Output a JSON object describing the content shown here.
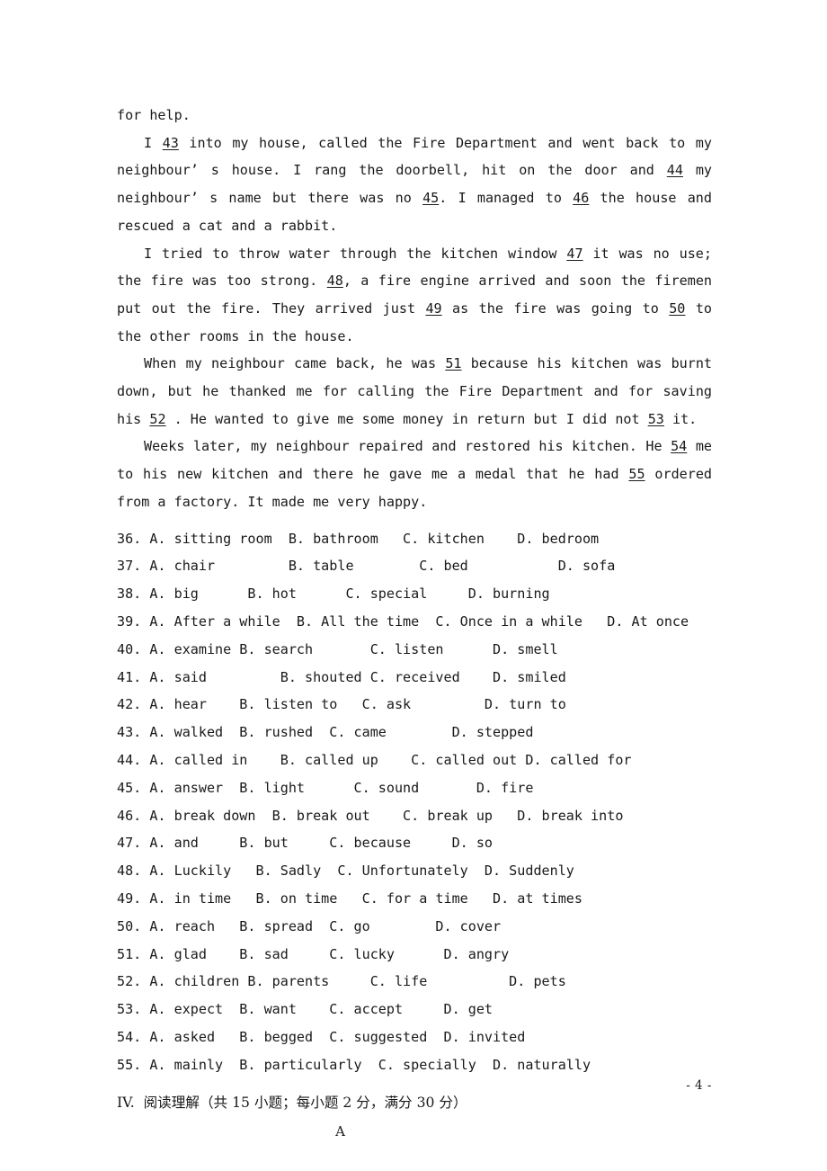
{
  "document": {
    "page_number": "- 4 -",
    "paragraphs": [
      {
        "id": "p-continuation",
        "indent": false,
        "runs": [
          {
            "t": "for help."
          }
        ]
      },
      {
        "id": "p-43-46",
        "indent": true,
        "runs": [
          {
            "t": "I "
          },
          {
            "t": "43",
            "blank": true
          },
          {
            "t": " into my house, called the Fire Department and went back to my neighbour’ s house. I rang the doorbell, hit on the door and "
          },
          {
            "t": "44",
            "blank": true
          },
          {
            "t": " my neighbour’ s name but there was no "
          },
          {
            "t": "45",
            "blank": true
          },
          {
            "t": ". I managed to "
          },
          {
            "t": "46",
            "blank": true
          },
          {
            "t": " the house and rescued a cat and a rabbit."
          }
        ]
      },
      {
        "id": "p-47-50",
        "indent": true,
        "runs": [
          {
            "t": "I tried to throw water through the kitchen window "
          },
          {
            "t": "47",
            "blank": true
          },
          {
            "t": " it was no use; the fire was too strong. "
          },
          {
            "t": "48",
            "blank": true
          },
          {
            "t": ", a fire engine arrived and soon the firemen put out the fire. They arrived just "
          },
          {
            "t": "49",
            "blank": true
          },
          {
            "t": " as the fire was going to "
          },
          {
            "t": "50",
            "blank": true
          },
          {
            "t": " to the other rooms in the house."
          }
        ]
      },
      {
        "id": "p-51-53",
        "indent": true,
        "runs": [
          {
            "t": "When my neighbour came back, he was "
          },
          {
            "t": "51",
            "blank": true
          },
          {
            "t": " because his kitchen was burnt down, but he thanked me for calling the Fire Department and for saving his "
          },
          {
            "t": "52",
            "blank": true
          },
          {
            "t": " . He wanted to give me some money in return but I did not "
          },
          {
            "t": "53",
            "blank": true
          },
          {
            "t": " it."
          }
        ]
      },
      {
        "id": "p-54-55",
        "indent": true,
        "runs": [
          {
            "t": "Weeks later, my neighbour repaired and restored his kitchen. He "
          },
          {
            "t": "54",
            "blank": true
          },
          {
            "t": " me to his new kitchen and there he gave me a medal that he had "
          },
          {
            "t": "55",
            "blank": true
          },
          {
            "t": " ordered from a factory. It made me very happy."
          }
        ]
      }
    ],
    "options": [
      {
        "number": "36.",
        "line": "36. A. sitting room  B. bathroom   C. kitchen    D. bedroom"
      },
      {
        "number": "37.",
        "line": "37. A. chair         B. table        C. bed           D. sofa"
      },
      {
        "number": "38.",
        "line": "38. A. big      B. hot      C. special     D. burning"
      },
      {
        "number": "39.",
        "line": "39. A. After a while  B. All the time  C. Once in a while   D. At once"
      },
      {
        "number": "40.",
        "line": "40. A. examine B. search       C. listen      D. smell"
      },
      {
        "number": "41.",
        "line": "41. A. said         B. shouted C. received    D. smiled"
      },
      {
        "number": "42.",
        "line": "42. A. hear    B. listen to   C. ask         D. turn to"
      },
      {
        "number": "43.",
        "line": "43. A. walked  B. rushed  C. came        D. stepped"
      },
      {
        "number": "44.",
        "line": "44. A. called in    B. called up    C. called out D. called for"
      },
      {
        "number": "45.",
        "line": "45. A. answer  B. light      C. sound       D. fire"
      },
      {
        "number": "46.",
        "line": "46. A. break down  B. break out    C. break up   D. break into"
      },
      {
        "number": "47.",
        "line": "47. A. and     B. but     C. because     D. so"
      },
      {
        "number": "48.",
        "line": "48. A. Luckily   B. Sadly  C. Unfortunately  D. Suddenly"
      },
      {
        "number": "49.",
        "line": "49. A. in time   B. on time   C. for a time   D. at times"
      },
      {
        "number": "50.",
        "line": "50. A. reach   B. spread  C. go        D. cover"
      },
      {
        "number": "51.",
        "line": "51. A. glad    B. sad     C. lucky      D. angry"
      },
      {
        "number": "52.",
        "line": "52. A. children B. parents     C. life          D. pets"
      },
      {
        "number": "53.",
        "line": "53. A. expect  B. want    C. accept     D. get"
      },
      {
        "number": "54.",
        "line": "54. A. asked   B. begged  C. suggested  D. invited"
      },
      {
        "number": "55.",
        "line": "55. A. mainly  B. particularly  C. specially  D. naturally"
      }
    ],
    "section_heading": "IV.  阅读理解（共 15 小题；每小题 2 分，满分 30 分）",
    "passage_label": "A"
  }
}
